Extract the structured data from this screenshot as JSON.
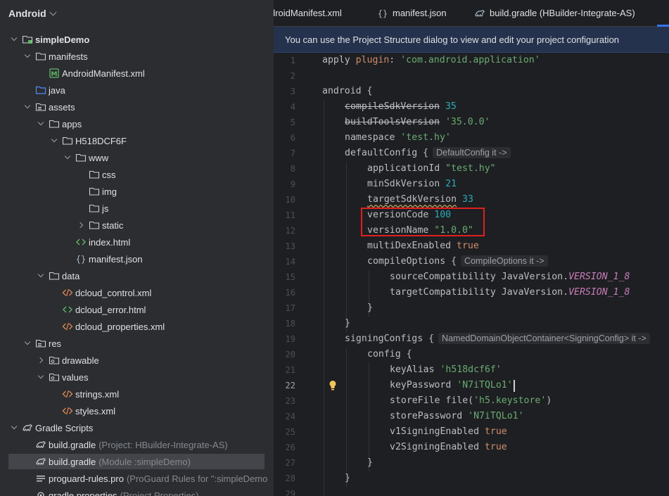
{
  "project_panel": {
    "title": "Android",
    "tree": [
      {
        "label": "simpleDemo",
        "bold": true,
        "icon": "module-folder-icon",
        "arrow": "down"
      },
      {
        "label": "manifests",
        "icon": "folder-icon",
        "arrow": "down"
      },
      {
        "label": "AndroidManifest.xml",
        "icon": "manifest-file-icon",
        "arrow": "none"
      },
      {
        "label": "java",
        "icon": "source-folder-icon",
        "arrow": "none"
      },
      {
        "label": "assets",
        "icon": "resource-folder-icon",
        "arrow": "down"
      },
      {
        "label": "apps",
        "icon": "folder-icon",
        "arrow": "down"
      },
      {
        "label": "H518DCF6F",
        "icon": "folder-icon",
        "arrow": "down"
      },
      {
        "label": "www",
        "icon": "folder-icon",
        "arrow": "down"
      },
      {
        "label": "css",
        "icon": "folder-icon",
        "arrow": "none"
      },
      {
        "label": "img",
        "icon": "folder-icon",
        "arrow": "none"
      },
      {
        "label": "js",
        "icon": "folder-icon",
        "arrow": "none"
      },
      {
        "label": "static",
        "icon": "folder-icon",
        "arrow": "right"
      },
      {
        "label": "index.html",
        "icon": "html-file-icon",
        "arrow": "none"
      },
      {
        "label": "manifest.json",
        "icon": "json-file-icon",
        "arrow": "none"
      },
      {
        "label": "data",
        "icon": "folder-icon",
        "arrow": "down"
      },
      {
        "label": "dcloud_control.xml",
        "icon": "xml-file-icon",
        "arrow": "none"
      },
      {
        "label": "dcloud_error.html",
        "icon": "html-file-icon",
        "arrow": "none"
      },
      {
        "label": "dcloud_properties.xml",
        "icon": "xml-file-icon",
        "arrow": "none"
      },
      {
        "label": "res",
        "icon": "resource-folder-icon",
        "arrow": "down"
      },
      {
        "label": "drawable",
        "icon": "res-subfolder-icon",
        "arrow": "right"
      },
      {
        "label": "values",
        "icon": "res-subfolder-icon",
        "arrow": "down"
      },
      {
        "label": "strings.xml",
        "icon": "xml-file-icon",
        "arrow": "none"
      },
      {
        "label": "styles.xml",
        "icon": "xml-file-icon",
        "arrow": "none"
      },
      {
        "label": "Gradle Scripts",
        "icon": "gradle-icon",
        "arrow": "down"
      },
      {
        "label": "build.gradle",
        "sub": "(Project: HBuilder-Integrate-AS)",
        "icon": "gradle-icon",
        "arrow": "none"
      },
      {
        "label": "build.gradle",
        "sub": "(Module :simpleDemo)",
        "icon": "gradle-icon",
        "arrow": "none",
        "selected": true
      },
      {
        "label": "proguard-rules.pro",
        "sub": "(ProGuard Rules for \":simpleDemo",
        "icon": "text-file-icon",
        "arrow": "none"
      },
      {
        "label": "gradle.properties",
        "sub": "(Project Properties)",
        "icon": "settings-file-icon",
        "arrow": "none"
      }
    ]
  },
  "tabs": [
    {
      "label": "droidManifest.xml",
      "icon": "none"
    },
    {
      "label": "manifest.json",
      "icon": "json-file-icon"
    },
    {
      "label": "build.gradle (HBuilder-Integrate-AS)",
      "icon": "gradle-icon"
    }
  ],
  "banner": {
    "text": "You can use the Project Structure dialog to view and edit your project configuration"
  },
  "editor": {
    "current_line": 22,
    "lines": [
      {
        "n": "1",
        "indent": 0,
        "tokens": [
          [
            "apply ",
            "p"
          ],
          [
            "plugin",
            "kw"
          ],
          [
            ": ",
            "p"
          ],
          [
            "'com.android.application'",
            "str"
          ]
        ]
      },
      {
        "n": "2",
        "indent": 0,
        "tokens": []
      },
      {
        "n": "3",
        "indent": 0,
        "tokens": [
          [
            "android {",
            "p"
          ]
        ]
      },
      {
        "n": "4",
        "indent": 1,
        "tokens": [
          [
            "compileSdkVersion",
            "strike"
          ],
          [
            " ",
            "p"
          ],
          [
            "35",
            "num"
          ]
        ]
      },
      {
        "n": "5",
        "indent": 1,
        "tokens": [
          [
            "buildToolsVersion",
            "strike"
          ],
          [
            " ",
            "p"
          ],
          [
            "'35.0.0'",
            "str"
          ]
        ]
      },
      {
        "n": "6",
        "indent": 1,
        "tokens": [
          [
            "namespace ",
            "p"
          ],
          [
            "'test.hy'",
            "str"
          ]
        ]
      },
      {
        "n": "7",
        "indent": 1,
        "tokens": [
          [
            "defaultConfig {",
            "p"
          ],
          [
            "DefaultConfig it ->",
            "hint"
          ]
        ]
      },
      {
        "n": "8",
        "indent": 2,
        "tokens": [
          [
            "applicationId ",
            "p"
          ],
          [
            "\"test.hy\"",
            "str"
          ]
        ]
      },
      {
        "n": "9",
        "indent": 2,
        "tokens": [
          [
            "minSdkVersion ",
            "p"
          ],
          [
            "21",
            "num"
          ]
        ]
      },
      {
        "n": "10",
        "indent": 2,
        "tokens": [
          [
            "targetSdkVersion",
            "squiggle"
          ],
          [
            " ",
            "p"
          ],
          [
            "33",
            "num"
          ]
        ]
      },
      {
        "n": "11",
        "indent": 2,
        "tokens": [
          [
            "versionCode ",
            "p"
          ],
          [
            "100",
            "num"
          ]
        ]
      },
      {
        "n": "12",
        "indent": 2,
        "tokens": [
          [
            "versionName ",
            "p"
          ],
          [
            "\"1.0.0\"",
            "str"
          ]
        ]
      },
      {
        "n": "13",
        "indent": 2,
        "tokens": [
          [
            "multiDexEnabled ",
            "p"
          ],
          [
            "true",
            "kw"
          ]
        ]
      },
      {
        "n": "14",
        "indent": 2,
        "tokens": [
          [
            "compileOptions {",
            "p"
          ],
          [
            "CompileOptions it ->",
            "hint"
          ]
        ]
      },
      {
        "n": "15",
        "indent": 3,
        "tokens": [
          [
            "sourceCompatibility JavaVersion.",
            "p"
          ],
          [
            "VERSION_1_8",
            "field"
          ]
        ]
      },
      {
        "n": "16",
        "indent": 3,
        "tokens": [
          [
            "targetCompatibility JavaVersion.",
            "p"
          ],
          [
            "VERSION_1_8",
            "field"
          ]
        ]
      },
      {
        "n": "17",
        "indent": 2,
        "tokens": [
          [
            "}",
            "p"
          ]
        ]
      },
      {
        "n": "18",
        "indent": 1,
        "tokens": [
          [
            "}",
            "p"
          ]
        ]
      },
      {
        "n": "19",
        "indent": 1,
        "tokens": [
          [
            "signingConfigs {",
            "p"
          ],
          [
            "NamedDomainObjectContainer<SigningConfig> it ->",
            "hint"
          ]
        ]
      },
      {
        "n": "20",
        "indent": 2,
        "tokens": [
          [
            "config {",
            "p"
          ]
        ]
      },
      {
        "n": "21",
        "indent": 3,
        "tokens": [
          [
            "keyAlias ",
            "p"
          ],
          [
            "'h518dcf6f'",
            "str"
          ]
        ]
      },
      {
        "n": "22",
        "indent": 3,
        "tokens": [
          [
            "keyPassword ",
            "p"
          ],
          [
            "'N7iTQLo1'",
            "str"
          ]
        ]
      },
      {
        "n": "23",
        "indent": 3,
        "tokens": [
          [
            "storeFile file(",
            "p"
          ],
          [
            "'h5.keystore'",
            "str"
          ],
          [
            ")",
            "p"
          ]
        ]
      },
      {
        "n": "24",
        "indent": 3,
        "tokens": [
          [
            "storePassword ",
            "p"
          ],
          [
            "'N7iTQLo1'",
            "str"
          ]
        ]
      },
      {
        "n": "25",
        "indent": 3,
        "tokens": [
          [
            "v1SigningEnabled ",
            "p"
          ],
          [
            "true",
            "kw"
          ]
        ]
      },
      {
        "n": "26",
        "indent": 3,
        "tokens": [
          [
            "v2SigningEnabled ",
            "p"
          ],
          [
            "true",
            "kw"
          ]
        ]
      },
      {
        "n": "27",
        "indent": 2,
        "tokens": [
          [
            "}",
            "p"
          ]
        ]
      },
      {
        "n": "28",
        "indent": 1,
        "tokens": [
          [
            "}",
            "p"
          ]
        ]
      },
      {
        "n": "29",
        "indent": 1,
        "tokens": []
      }
    ]
  },
  "colors": {
    "accent": "#3574f0",
    "highlight_box": "#e02020",
    "banner_bg": "#25324d"
  }
}
